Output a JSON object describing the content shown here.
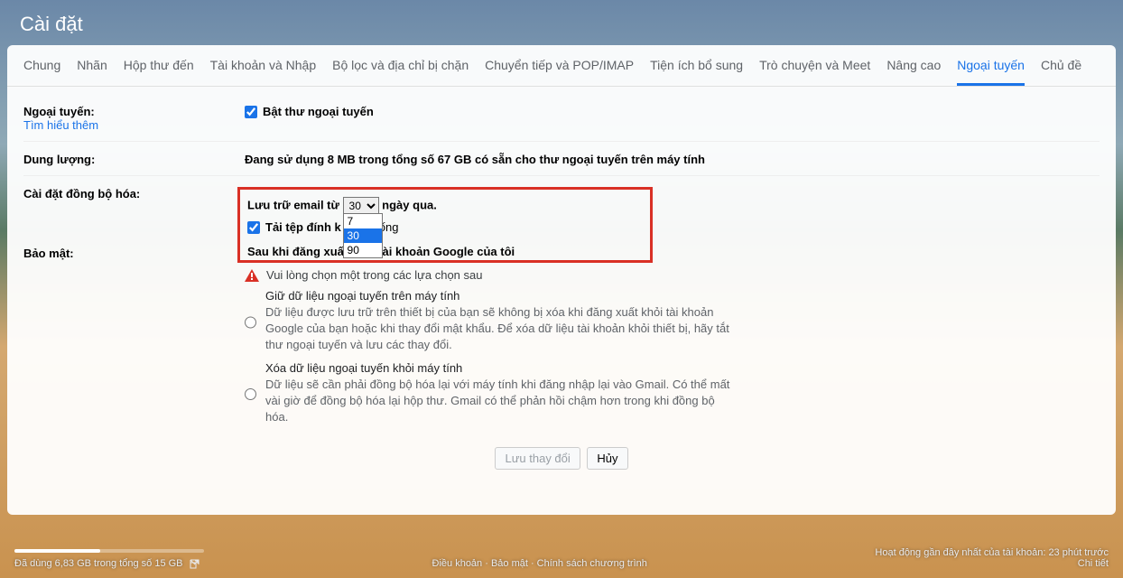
{
  "header": {
    "title": "Cài đặt"
  },
  "tabs": [
    "Chung",
    "Nhãn",
    "Hộp thư đến",
    "Tài khoản và Nhập",
    "Bộ lọc và địa chỉ bị chặn",
    "Chuyển tiếp và POP/IMAP",
    "Tiện ích bổ sung",
    "Trò chuyện và Meet",
    "Nâng cao",
    "Ngoại tuyến",
    "Chủ đề"
  ],
  "active_tab_index": 9,
  "offline": {
    "label": "Ngoại tuyến:",
    "learn_more": "Tìm hiểu thêm",
    "checkbox_label": "Bật thư ngoại tuyến"
  },
  "storage": {
    "label": "Dung lượng:",
    "text": "Đang sử dụng 8 MB trong tổng số 67 GB có sẵn cho thư ngoại tuyến trên máy tính"
  },
  "sync": {
    "label": "Cài đặt đồng bộ hóa:",
    "line1_prefix": "Lưu trữ email từ",
    "line1_suffix": "ngày qua.",
    "options": [
      "7",
      "30",
      "90"
    ],
    "selected": "30",
    "attachments": "Tải tệp đính k"
  },
  "security": {
    "label": "Bảo mật:",
    "heading": "Sau khi đăng xuất khỏi tài khoản Google của tôi",
    "warning": "Vui lòng chọn một trong các lựa chọn sau",
    "option1_title": "Giữ dữ liệu ngoại tuyến trên máy tính",
    "option1_desc": "Dữ liệu được lưu trữ trên thiết bị của bạn sẽ không bị xóa khi đăng xuất khỏi tài khoản Google của bạn hoặc khi thay đổi mật khẩu. Để xóa dữ liệu tài khoản khỏi thiết bị, hãy tắt thư ngoại tuyến và lưu các thay đổi.",
    "option2_title": "Xóa dữ liệu ngoại tuyến khỏi máy tính",
    "option2_desc": "Dữ liệu sẽ cần phải đồng bộ hóa lại với máy tính khi đăng nhập lại vào Gmail. Có thể mất vài giờ để đồng bộ hóa lại hộp thư. Gmail có thể phản hồi chậm hơn trong khi đồng bộ hóa."
  },
  "buttons": {
    "save": "Lưu thay đổi",
    "cancel": "Hủy"
  },
  "footer": {
    "storage": "Đã dùng 6,83 GB trong tổng số 15 GB",
    "links": "Điều khoản · Bảo mật · Chính sách chương trình",
    "activity1": "Hoạt động gần đây nhất của tài khoản: 23 phút trước",
    "activity2": "Chi tiết"
  }
}
